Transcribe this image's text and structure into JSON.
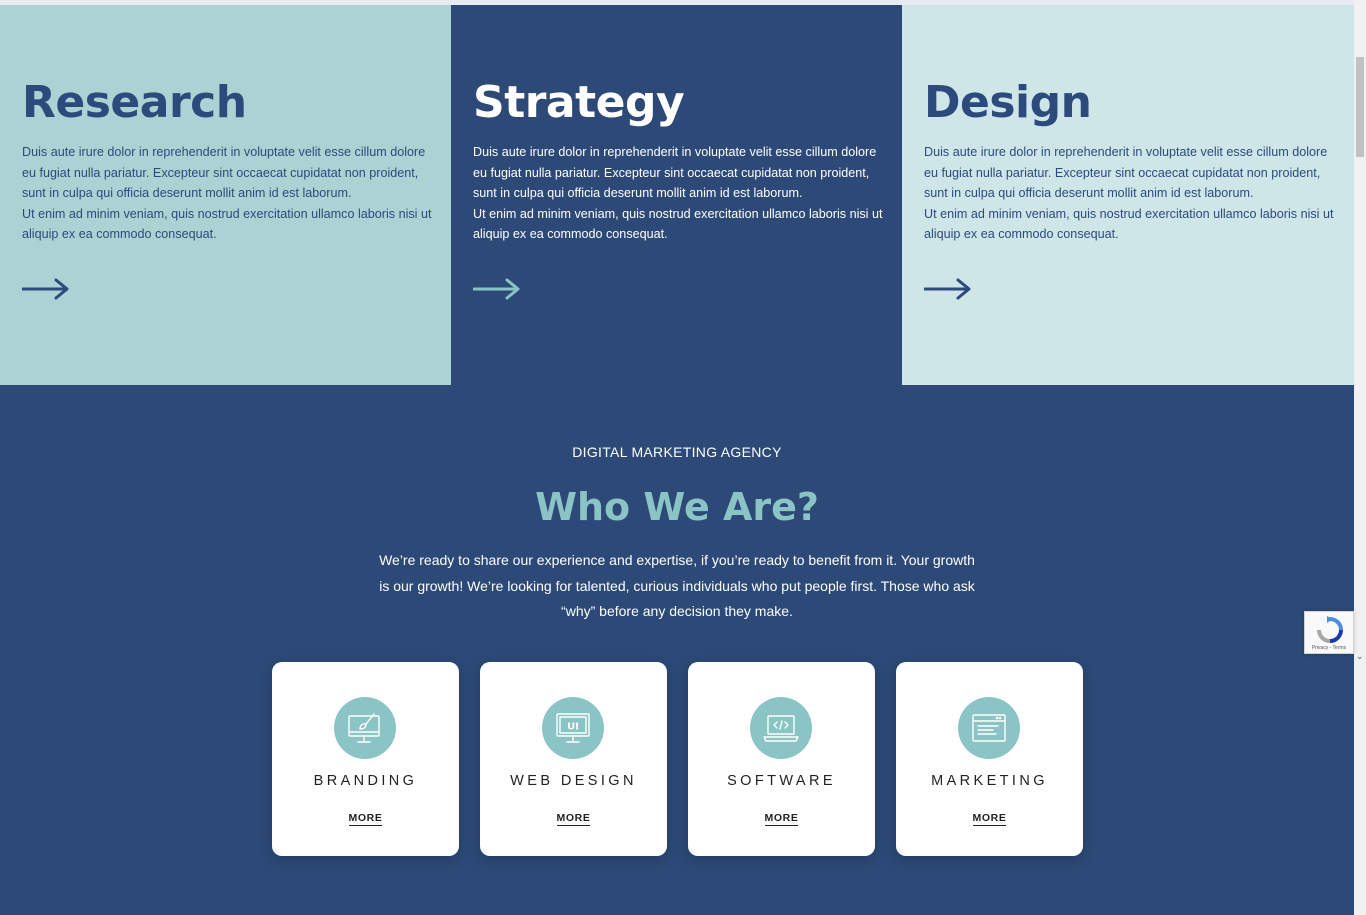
{
  "panels": [
    {
      "title": "Research",
      "body": "Duis aute irure dolor in reprehenderit in voluptate velit esse cillum dolore eu fugiat nulla pariatur. Excepteur sint occaecat cupidatat non proident, sunt in culpa qui officia deserunt mollit anim id est laborum.\nUt enim ad minim veniam, quis nostrud exercitation ullamco laboris nisi ut aliquip ex ea commodo consequat.",
      "arrow_icon": "arrow-right-icon",
      "arrow_color": "#2c4a7c"
    },
    {
      "title": "Strategy",
      "body": "Duis aute irure dolor in reprehenderit in voluptate velit esse cillum dolore eu fugiat nulla pariatur. Excepteur sint occaecat cupidatat non proident, sunt in culpa qui officia deserunt mollit anim id est laborum.\nUt enim ad minim veniam, quis nostrud exercitation ullamco laboris nisi ut aliquip ex ea commodo consequat.",
      "arrow_icon": "arrow-right-icon",
      "arrow_color": "#8ac4c4"
    },
    {
      "title": "Design",
      "body": "Duis aute irure dolor in reprehenderit in voluptate velit esse cillum dolore eu fugiat nulla pariatur. Excepteur sint occaecat cupidatat non proident, sunt in culpa qui officia deserunt mollit anim id est laborum.\nUt enim ad minim veniam, quis nostrud exercitation ullamco laboris nisi ut aliquip ex ea commodo consequat.",
      "arrow_icon": "arrow-right-icon",
      "arrow_color": "#2c4a7c"
    }
  ],
  "about": {
    "eyebrow": "DIGITAL MARKETING AGENCY",
    "heading": "Who We Are?",
    "lead": "We’re ready to share our experience and expertise, if you’re ready to benefit from it. Your growth is our growth! We’re looking for talented, curious individuals who put people first. Those who ask “why” before any decision they make."
  },
  "services": [
    {
      "title": "BRANDING",
      "more": "MORE",
      "icon": "monitor-brush-icon"
    },
    {
      "title": "WEB DESIGN",
      "more": "MORE",
      "icon": "monitor-ui-icon"
    },
    {
      "title": "SOFTWARE",
      "more": "MORE",
      "icon": "laptop-code-icon"
    },
    {
      "title": "MARKETING",
      "more": "MORE",
      "icon": "browser-window-icon"
    }
  ],
  "recaptcha": {
    "label": "Privacy - Terms",
    "icon": "recaptcha-icon"
  },
  "colors": {
    "navy": "#2c4977",
    "teal": "#8ac4c4",
    "light_teal": "#acd3d4",
    "pale_teal": "#cfe6e8"
  }
}
